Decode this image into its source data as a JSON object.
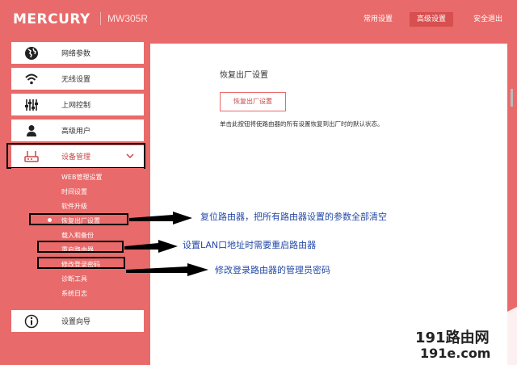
{
  "header": {
    "logo": "MERCURY",
    "model": "MW305R",
    "nav": [
      "常用设置",
      "高级设置",
      "安全退出"
    ],
    "active_nav": "高级设置"
  },
  "sidebar": {
    "items": [
      {
        "icon": "globe-icon",
        "label": "网络参数"
      },
      {
        "icon": "wifi-icon",
        "label": "无线设置"
      },
      {
        "icon": "sliders-icon",
        "label": "上网控制"
      },
      {
        "icon": "user-icon",
        "label": "高级用户"
      },
      {
        "icon": "router-icon",
        "label": "设备管理"
      }
    ],
    "submenu": [
      "WEB管理设置",
      "时间设置",
      "软件升级",
      "恢复出厂设置",
      "载入和备份",
      "重启路由器",
      "修改登录密码",
      "诊断工具",
      "系统日志"
    ],
    "active_submenu": "恢复出厂设置",
    "bottom": {
      "icon": "info-icon",
      "label": "设置向导"
    }
  },
  "main": {
    "title": "恢复出厂设置",
    "button_label": "恢复出厂设置",
    "description": "单击此按钮将使路由器的所有设置恢复到出厂时的默认状态。"
  },
  "annotations": [
    "复位路由器，把所有路由器设置的参数全部清空",
    "设置LAN口地址时需要重启路由器",
    "修改登录路由器的管理员密码"
  ],
  "watermark": {
    "line1": "191路由网",
    "line2": "191e.com"
  },
  "colors": {
    "brand": "#e96a6a",
    "active_nav": "#d74f4f",
    "annotation": "#2449a6"
  }
}
